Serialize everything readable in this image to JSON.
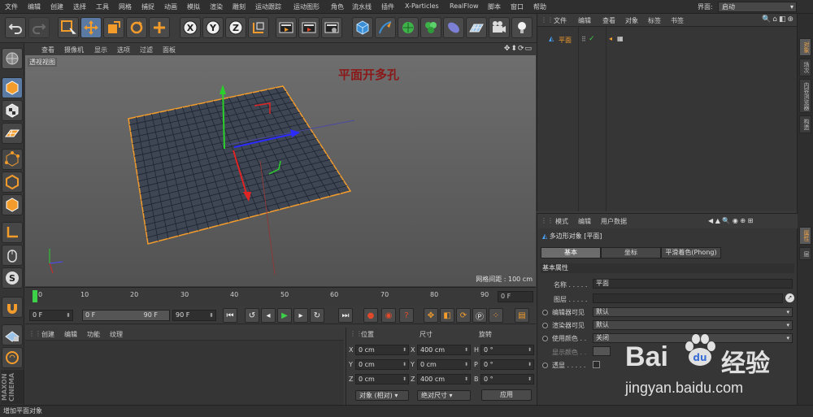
{
  "menubar": {
    "items": [
      "文件",
      "编辑",
      "创建",
      "选择",
      "工具",
      "网格",
      "捕捉",
      "动画",
      "模拟",
      "渲染",
      "雕刻",
      "运动跟踪",
      "运动图形",
      "角色",
      "流水线",
      "插件",
      "X-Particles",
      "RealFlow",
      "脚本",
      "窗口",
      "帮助"
    ],
    "layout_label": "界面:",
    "layout_value": "启动"
  },
  "toolbar": {
    "icons": [
      "undo-icon",
      "redo-icon",
      "live-select-icon",
      "move-icon",
      "scale-icon",
      "rotate-icon",
      "add-icon",
      "x-axis-icon",
      "y-axis-icon",
      "z-axis-icon",
      "coordinate-system-icon",
      "render-view-icon",
      "render-picture-queue-icon",
      "render-settings-icon",
      "cube-icon",
      "pen-icon",
      "subdivision-icon",
      "cloner-icon",
      "deformer-icon",
      "floor-icon",
      "camera-icon",
      "light-icon"
    ],
    "axis_x": "X",
    "axis_y": "Y",
    "axis_z": "Z"
  },
  "viewport": {
    "menu": [
      "查看",
      "摄像机",
      "显示",
      "选项",
      "过滤",
      "面板"
    ],
    "label": "透视视图",
    "title": "平面开多孔",
    "grid_info": "网格间距 : 100 cm"
  },
  "timeline": {
    "ticks": [
      "0",
      "10",
      "20",
      "30",
      "40",
      "50",
      "60",
      "70",
      "80",
      "90"
    ],
    "current_frame": "0 F"
  },
  "transport": {
    "start": "0 F",
    "range_start": "0 F",
    "range_end": "90 F",
    "end": "90 F"
  },
  "material_manager": {
    "menu": [
      "创建",
      "编辑",
      "功能",
      "纹理"
    ]
  },
  "coordinates": {
    "headers": [
      "位置",
      "尺寸",
      "旋转"
    ],
    "rows": [
      {
        "axis": "X",
        "pos": "0 cm",
        "size_axis": "X",
        "size": "400 cm",
        "rot_axis": "H",
        "rot": "0 °"
      },
      {
        "axis": "Y",
        "pos": "0 cm",
        "size_axis": "Y",
        "size": "0 cm",
        "rot_axis": "P",
        "rot": "0 °"
      },
      {
        "axis": "Z",
        "pos": "0 cm",
        "size_axis": "Z",
        "size": "400 cm",
        "rot_axis": "B",
        "rot": "0 °"
      }
    ],
    "mode": "对象 (相对)",
    "size_mode": "绝对尺寸",
    "apply": "应用"
  },
  "status": "增加平面对象",
  "object_manager": {
    "menu": [
      "文件",
      "编辑",
      "查看",
      "对象",
      "标签",
      "书签"
    ],
    "object_name": "平面"
  },
  "side_tabs": {
    "top": [
      "对象",
      "场次",
      "内容浏览器",
      "构造"
    ],
    "bottom": [
      "属性",
      "层"
    ]
  },
  "attribute_manager": {
    "menu": [
      "模式",
      "编辑",
      "用户数据"
    ],
    "object_line": "多边形对象 [平面]",
    "tabs": [
      "基本",
      "坐标",
      "平滑着色(Phong)"
    ],
    "section": "基本属性",
    "name_label": "名称 . . . . .",
    "name_value": "平面",
    "layer_label": "图层 . . . . .",
    "editor_visible_label": "编辑器可见",
    "editor_visible_value": "默认",
    "render_visible_label": "渲染器可见",
    "render_visible_value": "默认",
    "use_color_label": "使用颜色 . .",
    "use_color_value": "关闭",
    "display_color_label": "显示颜色 . .",
    "xray_label": "透显 . . . . ."
  },
  "watermark": {
    "brand": "Bai",
    "brand_cn": "经验",
    "url": "jingyan.baidu.com"
  },
  "colors": {
    "accent_orange": "#f39c2c",
    "selection_blue": "#5b7aa3",
    "title_red": "#8b1818"
  }
}
